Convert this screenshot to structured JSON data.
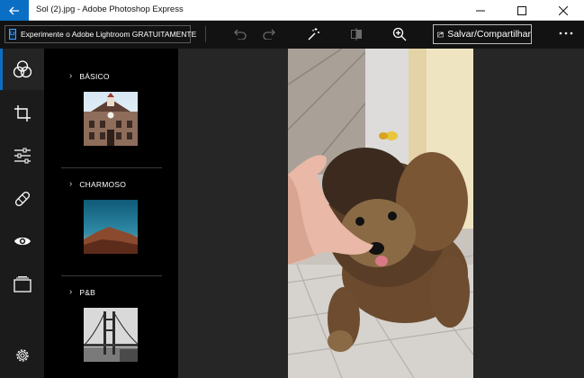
{
  "titlebar": {
    "title": "Sol (2).jpg - Adobe Photoshop Express"
  },
  "toolbar": {
    "lightroom_banner": "Experimente o Adobe Lightroom GRATUITAMENTE",
    "lightroom_badge": "Lr",
    "save_label": "Salvar/Compartilhar"
  },
  "panel": {
    "sections": [
      {
        "label": "BÁSICO"
      },
      {
        "label": "CHARMOSO"
      },
      {
        "label": "P&B"
      }
    ]
  },
  "colors": {
    "accent": "#0a6fc4",
    "rail_bg": "#1b1b1b",
    "canvas_bg": "#262626"
  },
  "icons": [
    "back-arrow-icon",
    "undo-icon",
    "redo-icon",
    "magic-wand-icon",
    "compare-icon",
    "zoom-icon",
    "share-icon",
    "looks-icon",
    "crop-icon",
    "adjustments-icon",
    "healing-icon",
    "eye-icon",
    "borders-icon",
    "settings-icon"
  ]
}
